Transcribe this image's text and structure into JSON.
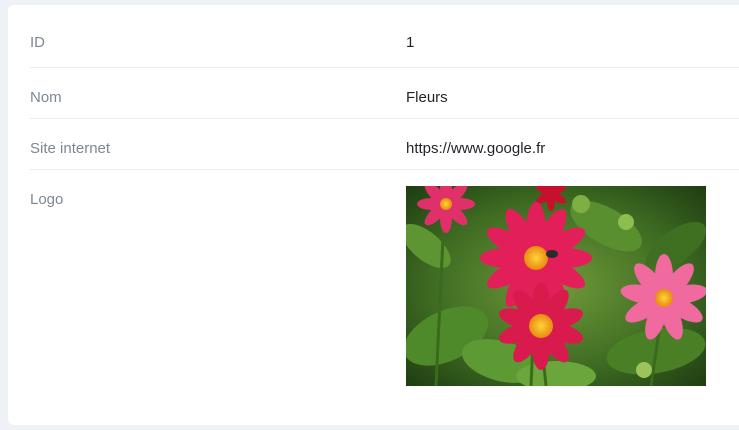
{
  "details": {
    "rows": [
      {
        "label": "ID",
        "value": "1"
      },
      {
        "label": "Nom",
        "value": "Fleurs"
      },
      {
        "label": "Site internet",
        "value": "https://www.google.fr"
      },
      {
        "label": "Logo"
      }
    ]
  },
  "colors": {
    "label": "#7d8794",
    "value": "#1f2328",
    "divider": "#e9ecf0",
    "page_bg": "#eef1f5"
  }
}
